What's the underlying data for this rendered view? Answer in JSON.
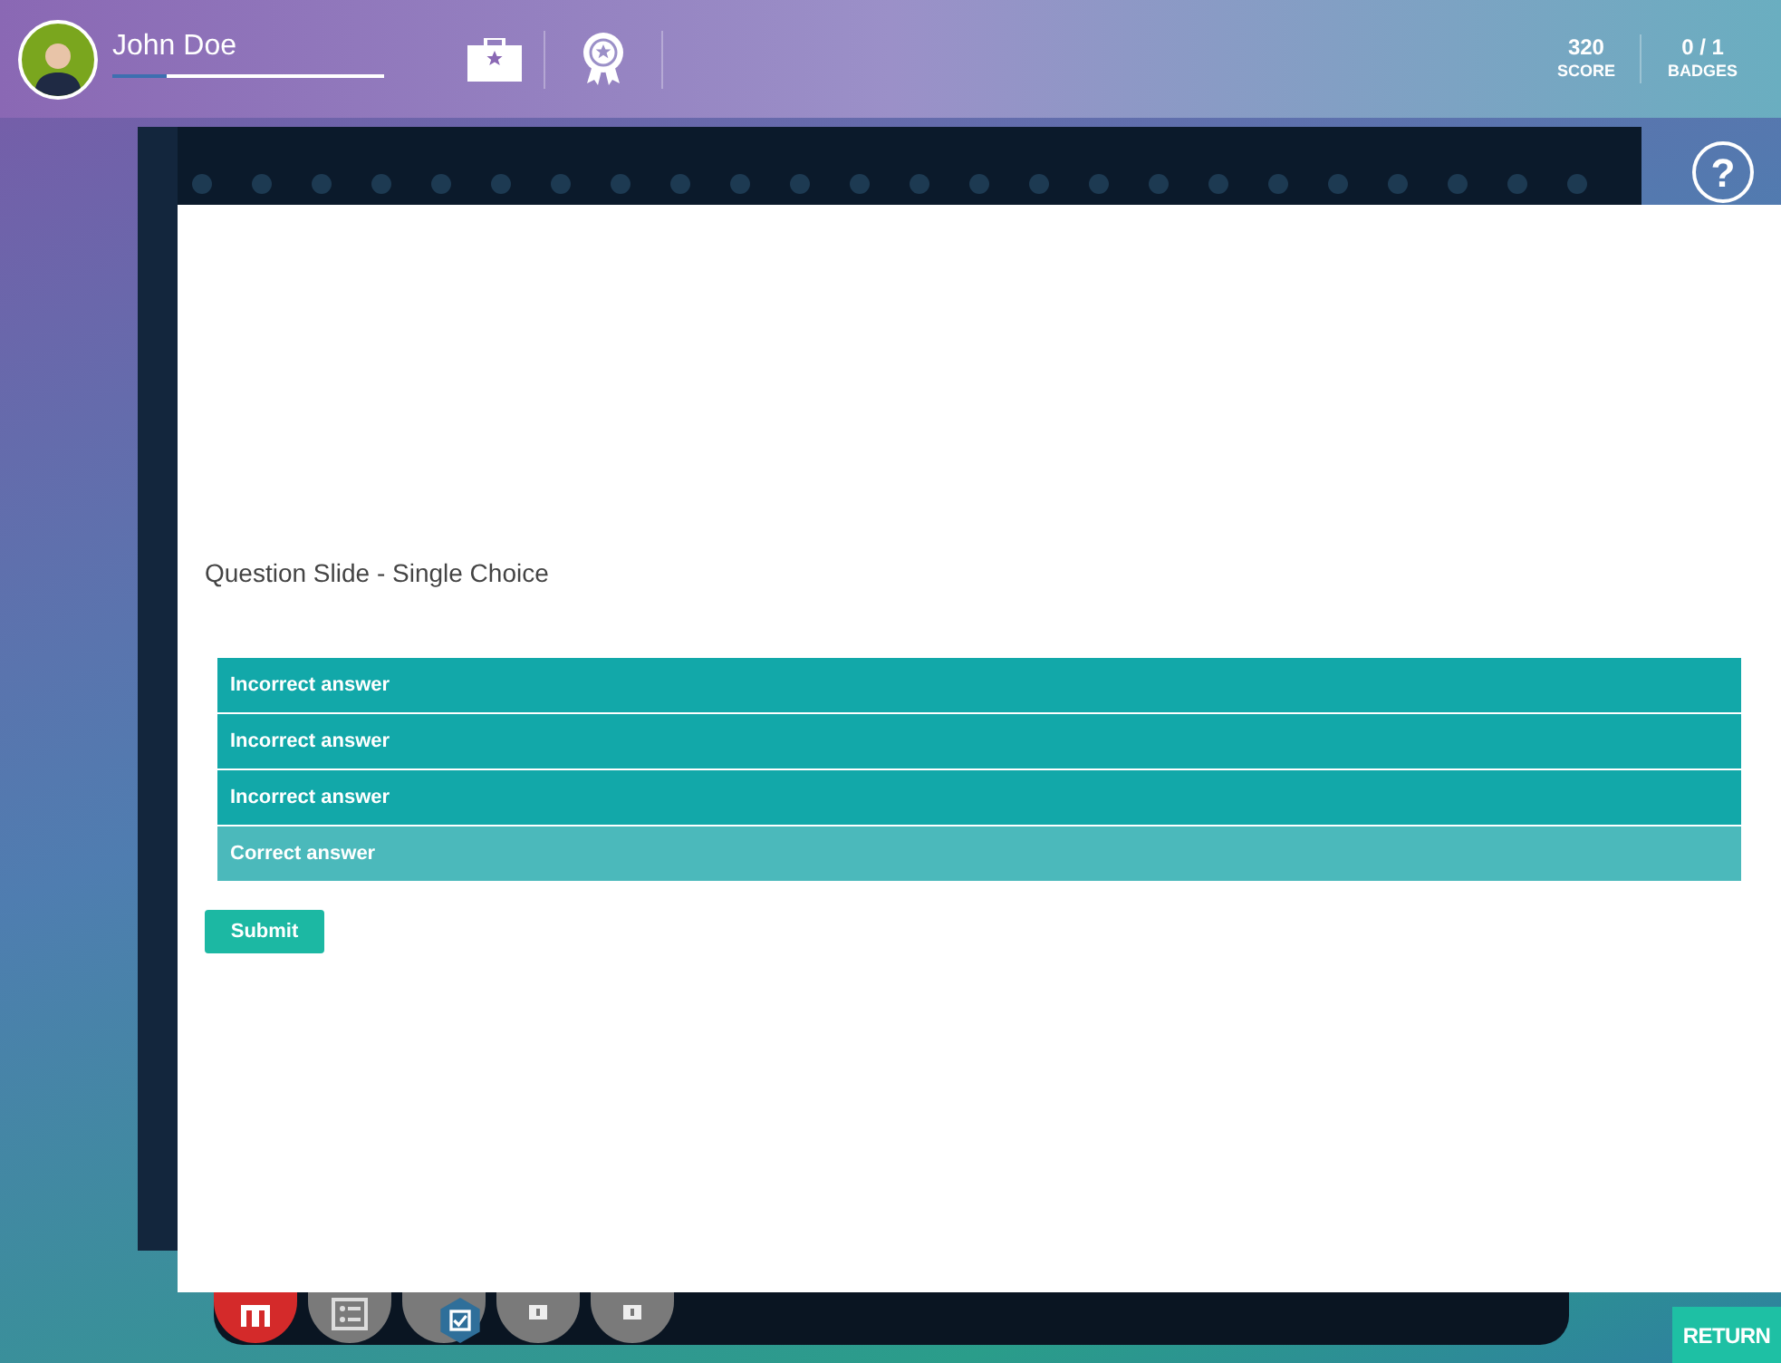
{
  "user": {
    "name": "John Doe",
    "level": 0.2
  },
  "stats": [
    {
      "value": "320",
      "label": "SCORE"
    },
    {
      "value": "0 / 1",
      "label": "BADGES"
    }
  ],
  "slide": {
    "title": "Question Slide - Single Choice",
    "options": [
      {
        "label": "Incorrect answer",
        "selected": false
      },
      {
        "label": "Incorrect answer",
        "selected": false
      },
      {
        "label": "Incorrect answer",
        "selected": false
      },
      {
        "label": "Correct answer",
        "selected": true
      }
    ],
    "submit": "Submit"
  },
  "help": "?",
  "dock": [
    {
      "kind": "open"
    },
    {
      "kind": "list"
    },
    {
      "kind": "locked"
    },
    {
      "kind": "locked"
    },
    {
      "kind": "locked"
    }
  ],
  "return": "RETURN"
}
